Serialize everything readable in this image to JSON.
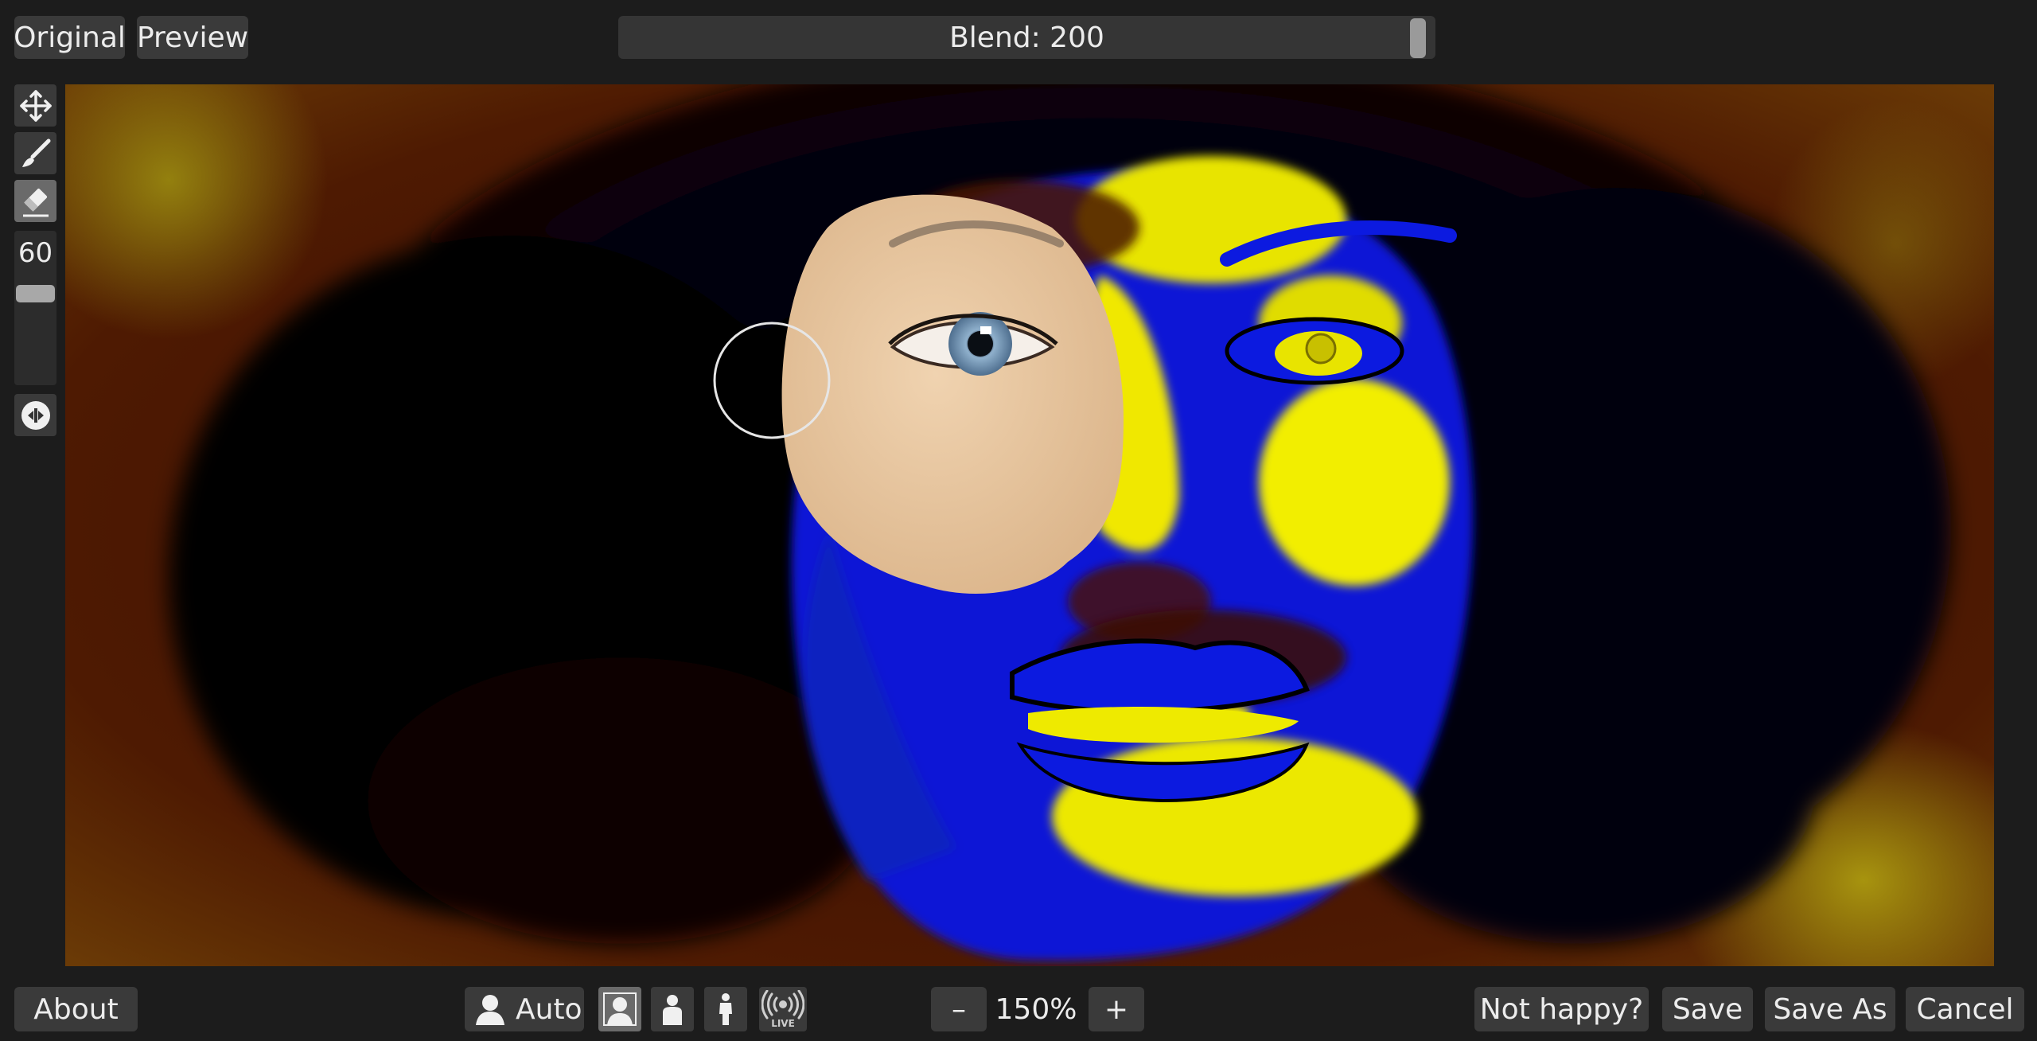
{
  "toolbar_top": {
    "original_label": "Original",
    "preview_label": "Preview",
    "blend_label": "Blend: 200"
  },
  "tools": {
    "brush_size": "60",
    "brush_size_level": 0.2,
    "icons": [
      "move-icon",
      "brush-icon",
      "eraser-icon",
      "reset-view-icon"
    ]
  },
  "bottom_bar": {
    "about_label": "About",
    "auto_label": "Auto",
    "mode_icons": [
      "face-mode-icon",
      "portrait-mode-icon",
      "full-body-mode-icon",
      "live-mode-icon"
    ],
    "live_badge": "LIVE",
    "zoom_out_label": "–",
    "zoom_value": "150%",
    "zoom_in_label": "+",
    "not_happy_label": "Not happy?",
    "save_label": "Save",
    "save_as_label": "Save As",
    "cancel_label": "Cancel"
  },
  "colors": {
    "background": "#1c1c1c",
    "button": "#3a3a3a",
    "thermal_yellow": "#f2f200",
    "thermal_blue": "#0a1adc",
    "thermal_dark_red": "#3a0c02",
    "skin": "#e9c9a4",
    "iris": "#7e9fbd"
  }
}
